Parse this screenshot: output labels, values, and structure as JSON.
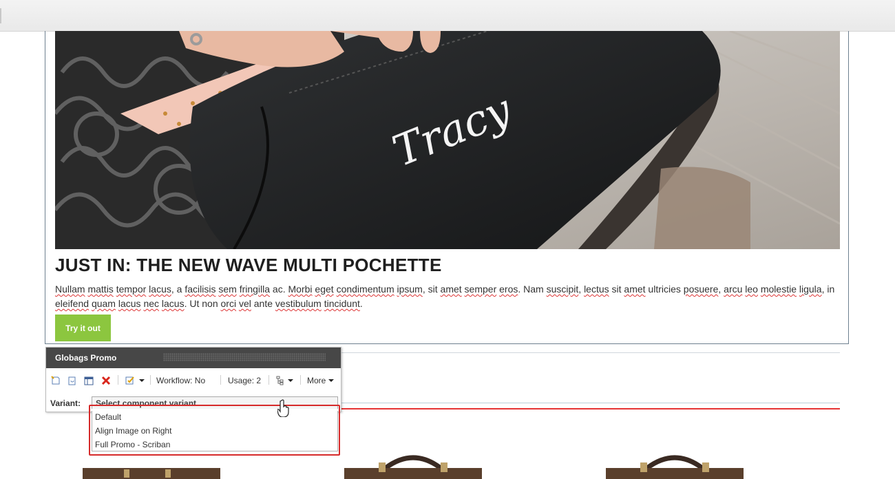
{
  "promo": {
    "title": "JUST IN: THE NEW WAVE MULTI POCHETTE",
    "body_segments": [
      {
        "t": "Nullam",
        "sq": true
      },
      {
        "t": " "
      },
      {
        "t": "mattis",
        "sq": true
      },
      {
        "t": " "
      },
      {
        "t": "tempor",
        "sq": true
      },
      {
        "t": " "
      },
      {
        "t": "lacus",
        "sq": true
      },
      {
        "t": ", a "
      },
      {
        "t": "facilisis",
        "sq": true
      },
      {
        "t": " "
      },
      {
        "t": "sem",
        "sq": true
      },
      {
        "t": " "
      },
      {
        "t": "fringilla",
        "sq": true
      },
      {
        "t": " ac. "
      },
      {
        "t": "Morbi",
        "sq": true
      },
      {
        "t": " "
      },
      {
        "t": "eget",
        "sq": true
      },
      {
        "t": " "
      },
      {
        "t": "condimentum",
        "sq": true
      },
      {
        "t": " "
      },
      {
        "t": "ipsum",
        "sq": true
      },
      {
        "t": ", sit "
      },
      {
        "t": "amet",
        "sq": true
      },
      {
        "t": " "
      },
      {
        "t": "semper",
        "sq": true
      },
      {
        "t": " "
      },
      {
        "t": "eros",
        "sq": true
      },
      {
        "t": ". Nam "
      },
      {
        "t": "suscipit",
        "sq": true
      },
      {
        "t": ", "
      },
      {
        "t": "lectus",
        "sq": true
      },
      {
        "t": " sit "
      },
      {
        "t": "amet",
        "sq": true
      },
      {
        "t": " ultricies "
      },
      {
        "t": "posuere",
        "sq": true
      },
      {
        "t": ", "
      },
      {
        "t": "arcu",
        "sq": true
      },
      {
        "t": " "
      },
      {
        "t": "leo",
        "sq": true
      },
      {
        "t": " "
      },
      {
        "t": "molestie",
        "sq": true
      },
      {
        "t": " "
      },
      {
        "t": "ligula",
        "sq": true
      },
      {
        "t": ", in "
      },
      {
        "t": "eleifend",
        "sq": true
      },
      {
        "t": " "
      },
      {
        "t": "quam",
        "sq": true
      },
      {
        "t": " "
      },
      {
        "t": "lacus",
        "sq": true
      },
      {
        "t": " "
      },
      {
        "t": "nec",
        "sq": true
      },
      {
        "t": " "
      },
      {
        "t": "lacus",
        "sq": true
      },
      {
        "t": ". Ut non "
      },
      {
        "t": "orci",
        "sq": true
      },
      {
        "t": " "
      },
      {
        "t": "vel",
        "sq": true
      },
      {
        "t": " ante "
      },
      {
        "t": "vestibulum",
        "sq": true
      },
      {
        "t": " "
      },
      {
        "t": "tincidunt",
        "sq": true
      },
      {
        "t": "."
      }
    ],
    "button_label": "Try it out",
    "image_text": "Tracy"
  },
  "chrome": {
    "title": "Globags Promo",
    "workflow_label": "Workflow: No",
    "usage_label": "Usage: 2",
    "more_label": "More",
    "variant_label": "Variant:",
    "variant_placeholder": "Select component variant",
    "variant_options": [
      "Default",
      "Align Image on Right",
      "Full Promo - Scriban"
    ]
  },
  "colors": {
    "button_bg": "#8cc63f",
    "chrome_header_bg": "#474747",
    "highlight_red": "#d62a2a",
    "delete_red": "#d9261c"
  },
  "icons": [
    "insert-icon",
    "copy-icon",
    "layout-icon",
    "delete-icon",
    "edit-icon",
    "tree-icon",
    "hand-cursor-icon"
  ]
}
